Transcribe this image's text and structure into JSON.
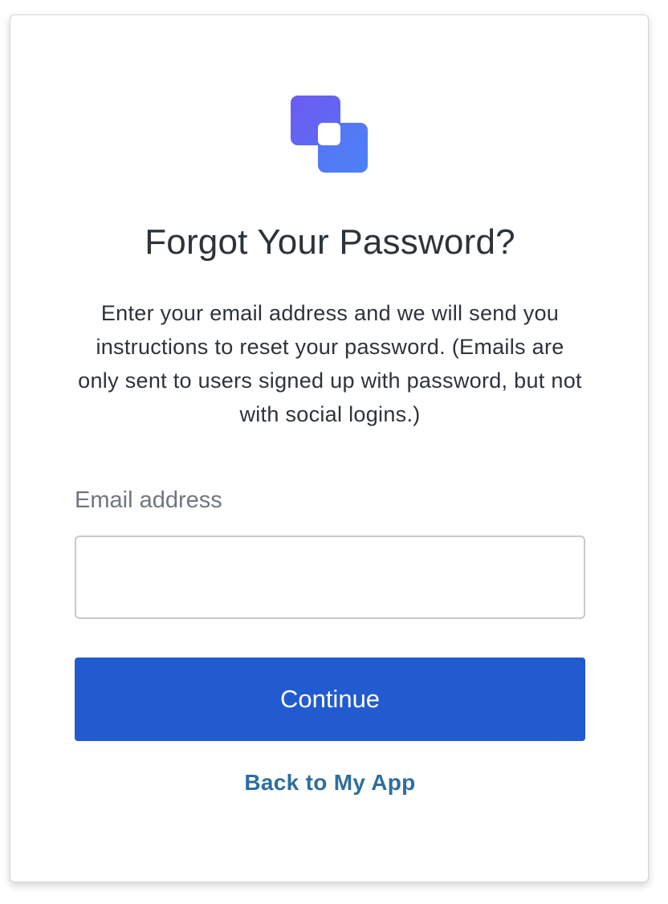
{
  "logo": {
    "icon": "app-logo-icon",
    "color_top": "#6366f1",
    "color_bottom": "#4f7ef5"
  },
  "header": {
    "title": "Forgot Your Password?"
  },
  "description": {
    "text": "Enter your email address and we will send you instructions to reset your password. (Emails are only sent to users signed up with password, but not with social logins.)"
  },
  "form": {
    "email_label": "Email address",
    "email_value": "",
    "continue_label": "Continue",
    "button_color": "#225bd0"
  },
  "footer": {
    "back_link": "Back to My App",
    "link_color": "#2f6e9e"
  }
}
